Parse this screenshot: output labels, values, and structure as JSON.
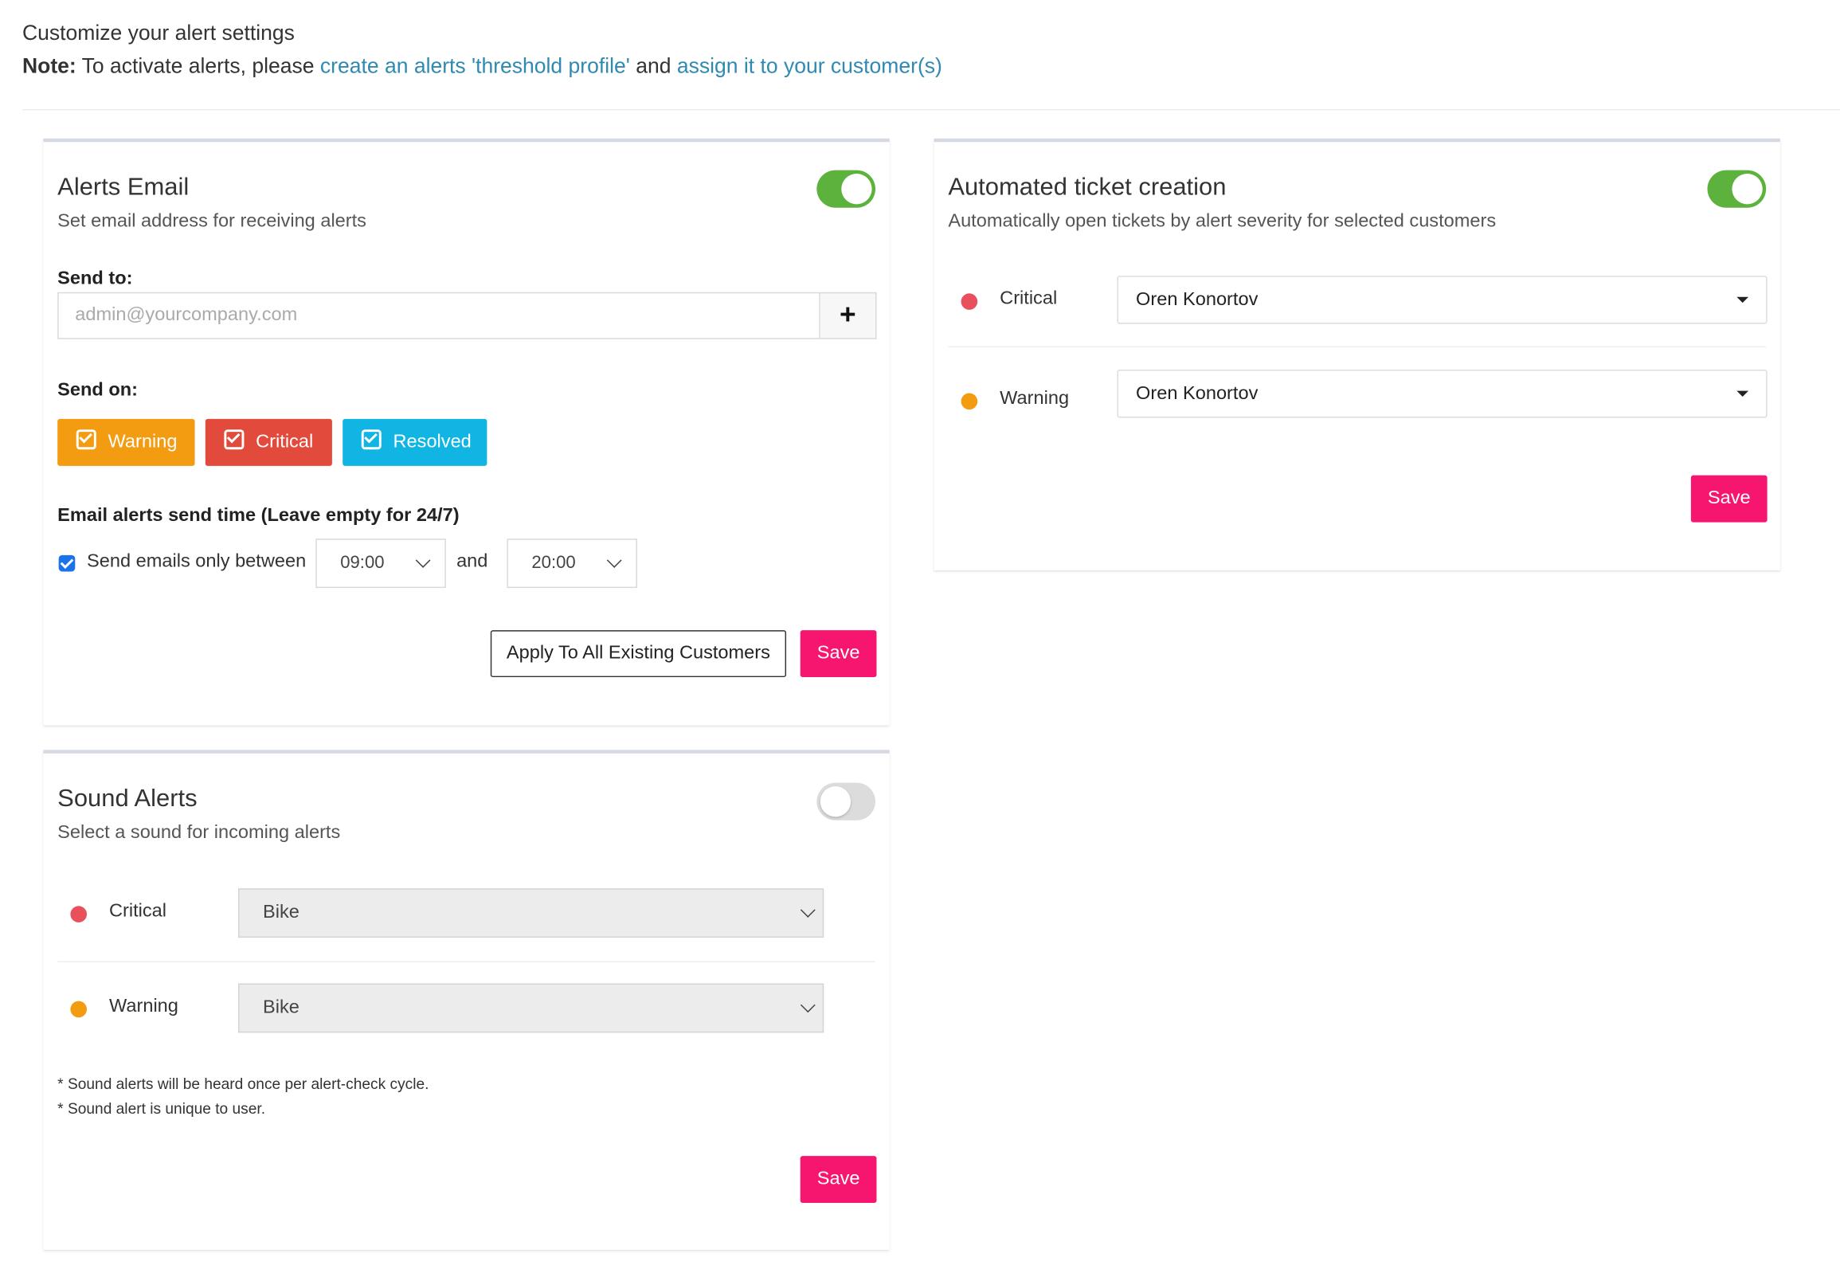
{
  "header": {
    "title": "Customize your alert settings",
    "note_label": "Note:",
    "note_text": " To activate alerts, please ",
    "link1": "create an alerts 'threshold profile'",
    "and": " and ",
    "link2": "assign it to your customer(s)"
  },
  "email_card": {
    "title": "Alerts Email",
    "subtitle": "Set email address for receiving alerts",
    "enabled": true,
    "send_to_label": "Send to:",
    "email_placeholder": "admin@yourcompany.com",
    "add_icon": "plus-icon",
    "send_on_label": "Send on:",
    "severity_buttons": [
      {
        "label": "Warning",
        "color": "#f39c12",
        "checked": true
      },
      {
        "label": "Critical",
        "color": "#e24a3b",
        "checked": true
      },
      {
        "label": "Resolved",
        "color": "#11b5e4",
        "checked": true
      }
    ],
    "time_label": "Email alerts send time (Leave empty for 24/7)",
    "only_between_label": "Send emails only between",
    "only_between_checked": true,
    "from_time": "09:00",
    "and_label": "and",
    "to_time": "20:00",
    "apply_all_label": "Apply To All Existing Customers",
    "save_label": "Save"
  },
  "ticket_card": {
    "title": "Automated ticket creation",
    "subtitle": "Automatically open tickets by alert severity for selected customers",
    "enabled": true,
    "rows": [
      {
        "severity": "Critical",
        "color": "#e8505b",
        "assignee": "Oren Konortov"
      },
      {
        "severity": "Warning",
        "color": "#f39c12",
        "assignee": "Oren Konortov"
      }
    ],
    "save_label": "Save"
  },
  "sound_card": {
    "title": "Sound Alerts",
    "subtitle": "Select a sound for incoming alerts",
    "enabled": false,
    "rows": [
      {
        "severity": "Critical",
        "color": "#e8505b",
        "sound": "Bike"
      },
      {
        "severity": "Warning",
        "color": "#f39c12",
        "sound": "Bike"
      }
    ],
    "notes": [
      "* Sound alerts will be heard once per alert-check cycle.",
      "* Sound alert is unique to user."
    ],
    "save_label": "Save"
  },
  "colors": {
    "accent_pink": "#f7166f",
    "toggle_on": "#5cb23c",
    "link": "#2f89b1"
  }
}
